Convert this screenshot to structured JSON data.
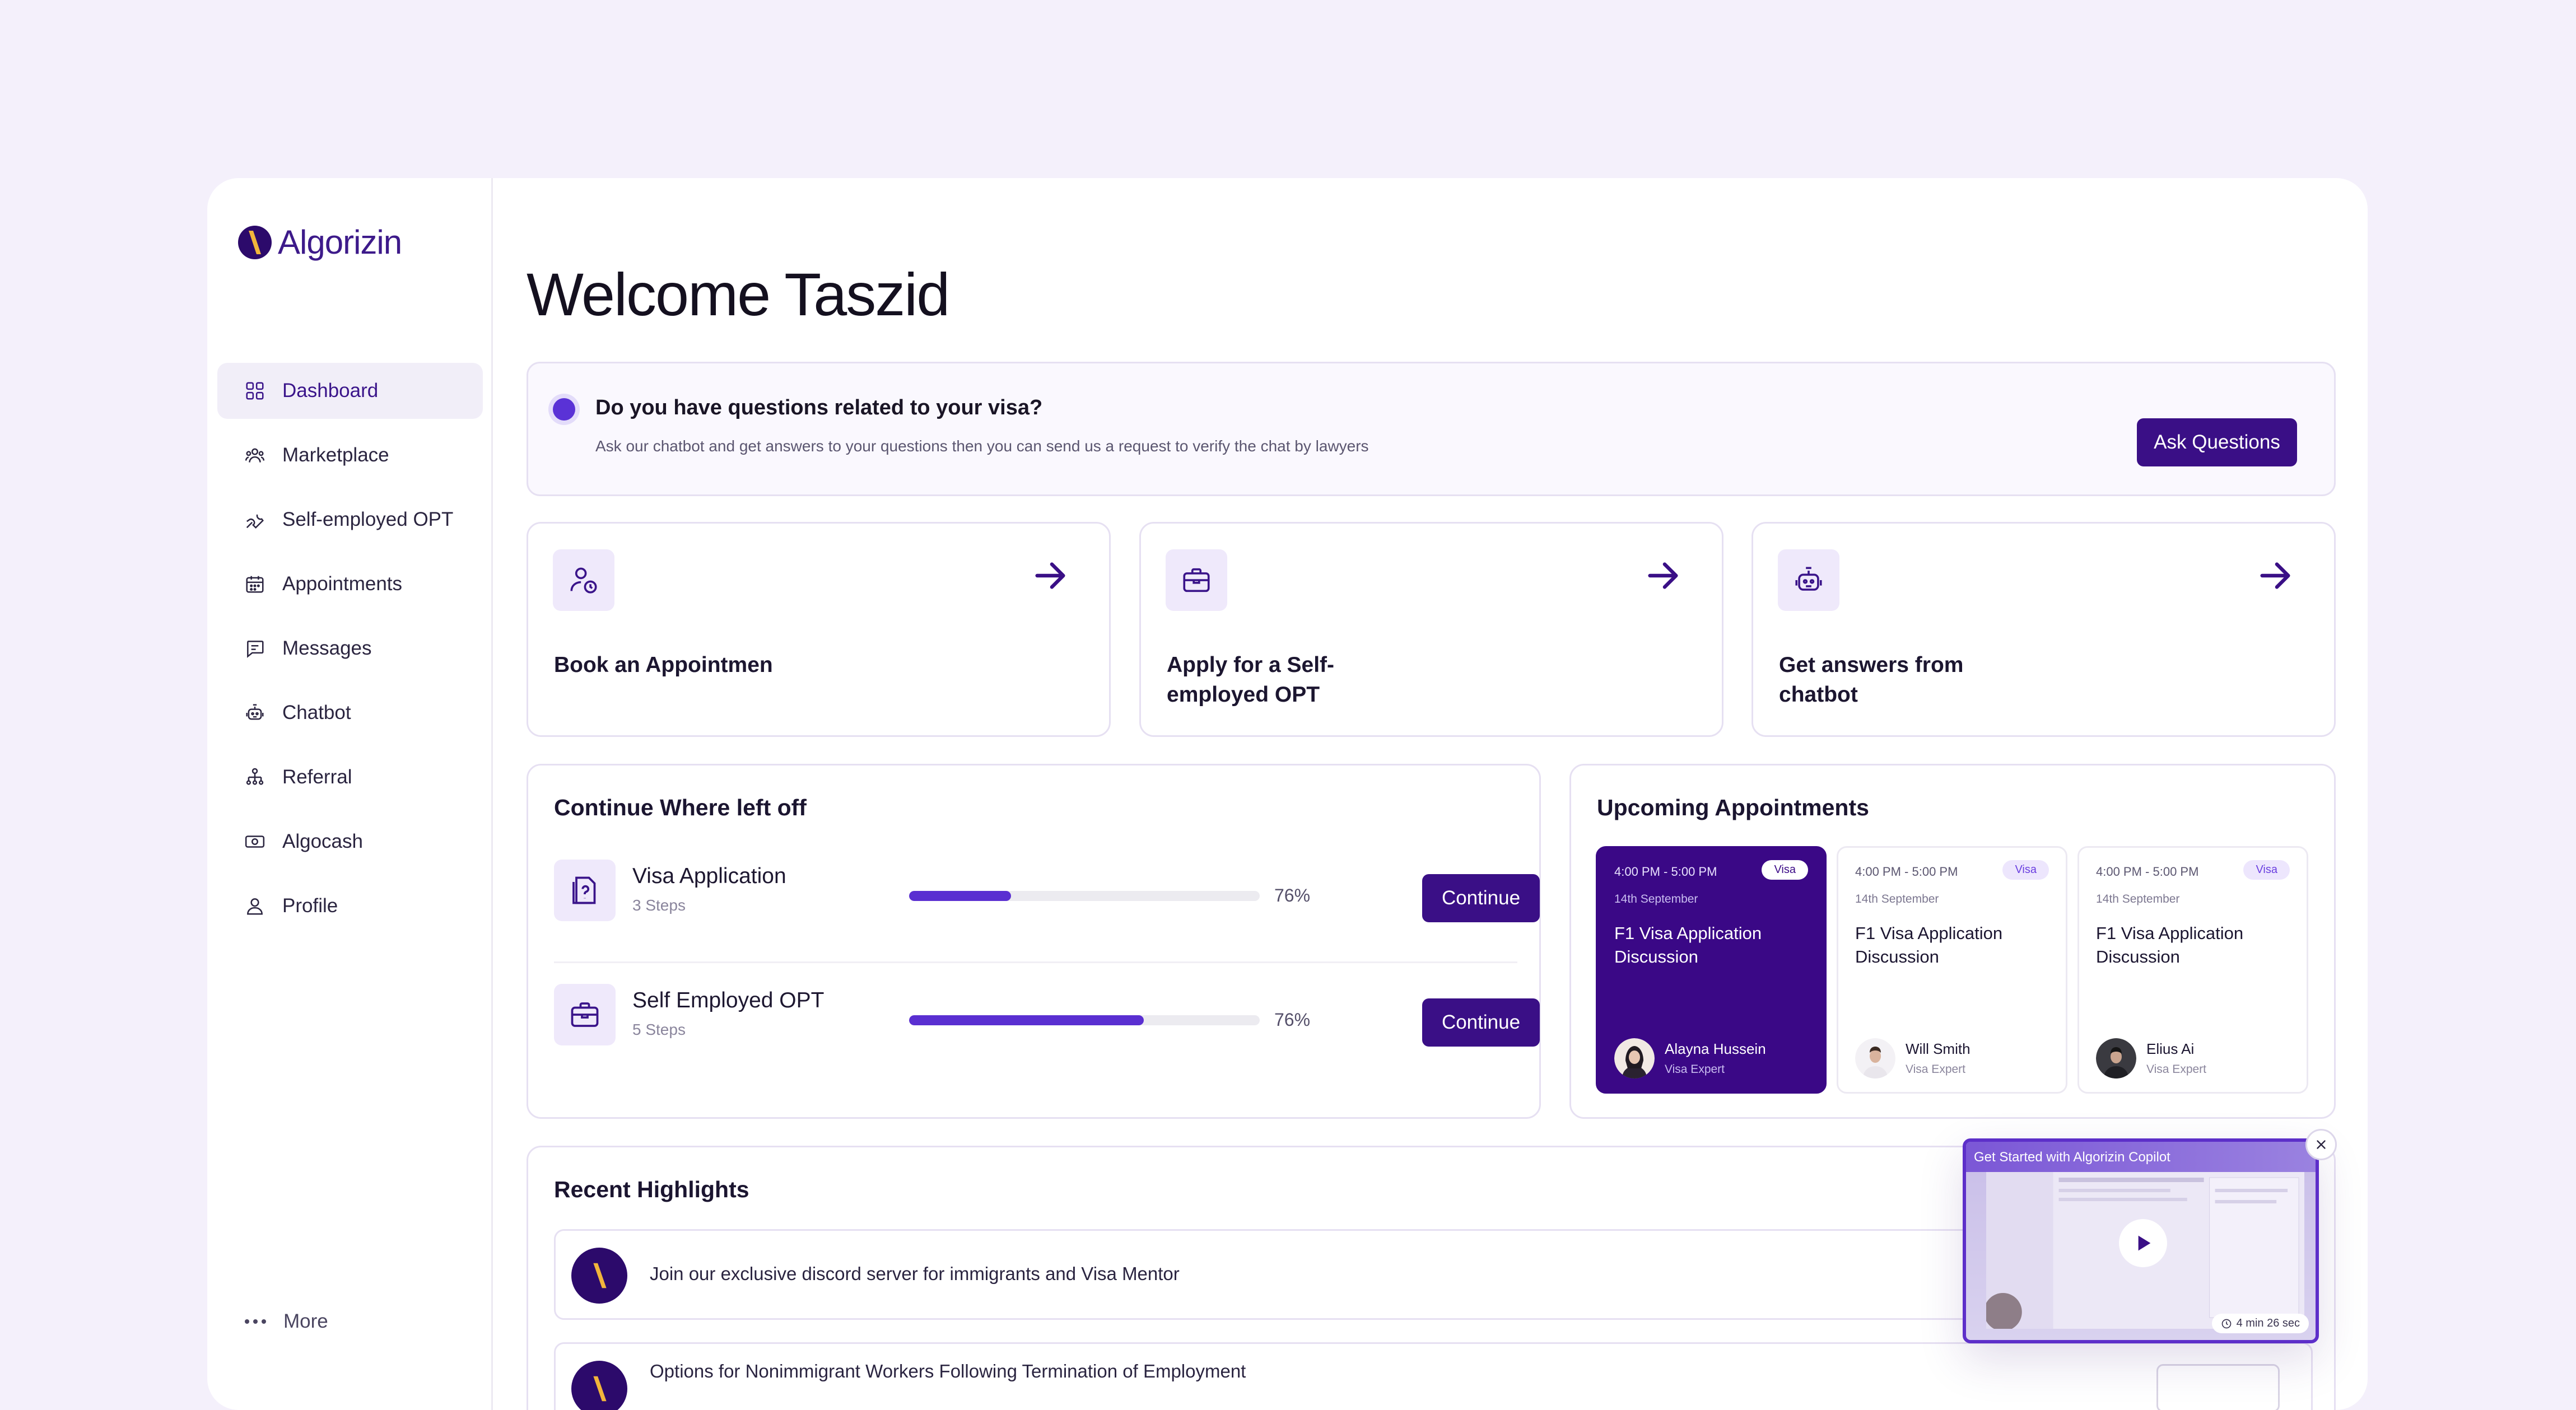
{
  "app": {
    "name": "Algorizin"
  },
  "sidebar": {
    "items": [
      {
        "label": "Dashboard",
        "icon": "grid-icon"
      },
      {
        "label": "Marketplace",
        "icon": "people-icon"
      },
      {
        "label": "Self-employed OPT",
        "icon": "wrench-icon"
      },
      {
        "label": "Appointments",
        "icon": "calendar-icon"
      },
      {
        "label": "Messages",
        "icon": "message-icon"
      },
      {
        "label": "Chatbot",
        "icon": "robot-icon"
      },
      {
        "label": "Referral",
        "icon": "referral-icon"
      },
      {
        "label": "Algocash",
        "icon": "cash-icon"
      },
      {
        "label": "Profile",
        "icon": "user-icon"
      }
    ],
    "active": "Dashboard",
    "more_label": "More"
  },
  "main": {
    "welcome": "Welcome Taszid",
    "question": {
      "title": "Do you have questions related to your visa?",
      "subtitle": "Ask our chatbot and get answers to your questions then you can send us a request to verify the chat by lawyers",
      "button": "Ask Questions"
    },
    "actions": [
      {
        "label": "Book an Appointmen",
        "icon": "user-clock-icon"
      },
      {
        "label": "Apply for a Self-employed OPT",
        "icon": "briefcase-icon"
      },
      {
        "label": "Get answers from chatbot",
        "icon": "robot-icon"
      }
    ],
    "continue": {
      "title": "Continue Where left off",
      "items": [
        {
          "name": "Visa Application",
          "steps": "3 Steps",
          "percent_label": "76%",
          "fill": 0.29,
          "button": "Continue"
        },
        {
          "name": "Self Employed OPT",
          "steps": "5 Steps",
          "percent_label": "76%",
          "fill": 0.67,
          "button": "Continue"
        }
      ]
    },
    "appointments": {
      "title": "Upcoming Appointments",
      "items": [
        {
          "time": "4:00 PM - 5:00 PM",
          "badge": "Visa",
          "date": "14th September",
          "title": "F1 Visa Application Discussion",
          "name": "Alayna Hussein",
          "role": "Visa Expert"
        },
        {
          "time": "4:00 PM - 5:00 PM",
          "badge": "Visa",
          "date": "14th September",
          "title": "F1 Visa Application Discussion",
          "name": "Will Smith",
          "role": "Visa Expert"
        },
        {
          "time": "4:00 PM - 5:00 PM",
          "badge": "Visa",
          "date": "14th September",
          "title": "F1 Visa Application Discussion",
          "name": "Elius Ai",
          "role": "Visa Expert"
        }
      ]
    },
    "highlights": {
      "title": "Recent Highlights",
      "items": [
        {
          "text": "Join our exclusive discord server for immigrants and Visa Mentor"
        },
        {
          "text": "Options for Nonimmigrant Workers Following Termination of Employment"
        }
      ]
    }
  },
  "video": {
    "title": "Get Started with Algorizin Copilot",
    "duration": "4 min 26 sec"
  },
  "colors": {
    "primary": "#3a0f86",
    "accent": "#5a2fd1",
    "background": "#f4f0fb"
  }
}
